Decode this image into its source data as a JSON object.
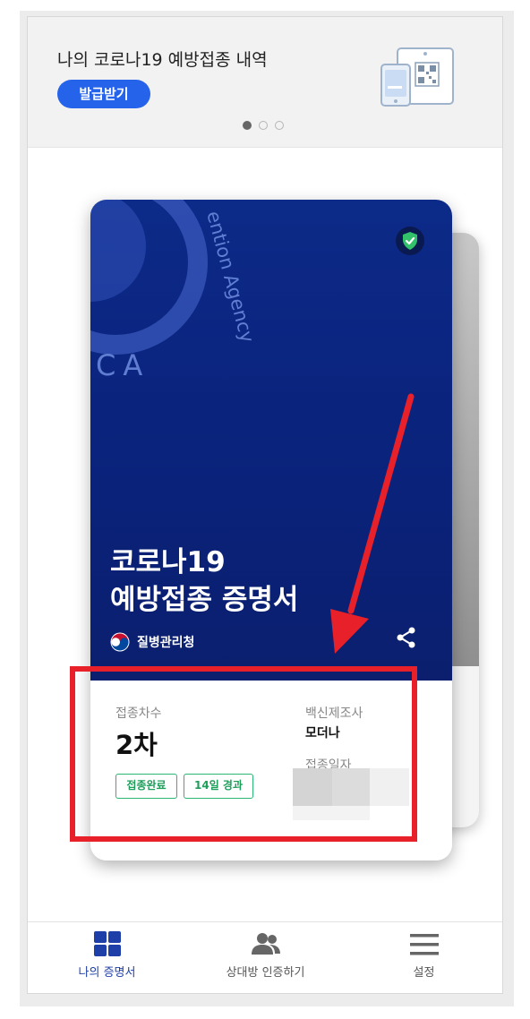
{
  "banner": {
    "title": "나의 코로나19 예방접종 내역",
    "button_label": "발급받기",
    "page_indicator": {
      "total": 3,
      "active": 1
    }
  },
  "card": {
    "title_line1": "코로나19",
    "title_line2": "예방접종 증명서",
    "agency_name": "질병관리청",
    "emblem_text_arc": "ention Agency",
    "emblem_text_left": "CA"
  },
  "info": {
    "dose_label": "접종차수",
    "dose_value": "2차",
    "status_tag": "접종완료",
    "elapsed_tag": "14일 경과",
    "manufacturer_label": "백신제조사",
    "manufacturer_value": "모더나",
    "date_label": "접종일자"
  },
  "nav": {
    "items": [
      {
        "label": "나의 증명서",
        "icon": "grid-icon",
        "active": true
      },
      {
        "label": "상대방 인증하기",
        "icon": "people-icon",
        "active": false
      },
      {
        "label": "설정",
        "icon": "menu-icon",
        "active": false
      }
    ]
  },
  "colors": {
    "primary": "#2563eb",
    "card_blue": "#0c2a88",
    "annotation_red": "#e8202a",
    "tag_green": "#2bb673",
    "nav_active": "#1f3fa8"
  }
}
